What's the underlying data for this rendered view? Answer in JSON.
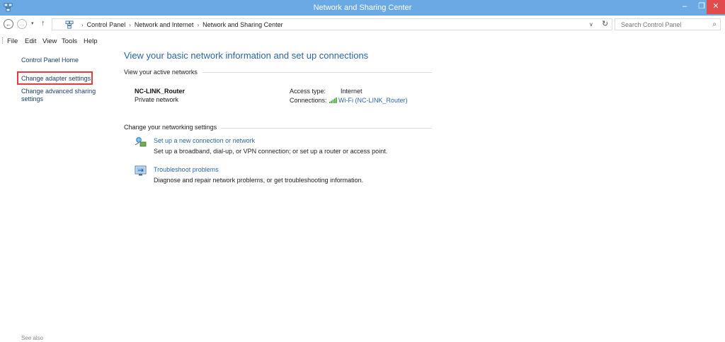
{
  "window": {
    "title": "Network and Sharing Center"
  },
  "window_controls": {
    "minimize": "–",
    "maximize": "❐",
    "close": "✕"
  },
  "nav": {
    "back": "←",
    "forward": "→",
    "recent": "▾",
    "up": "↑"
  },
  "address": {
    "crumbs": [
      "Control Panel",
      "Network and Internet",
      "Network and Sharing Center"
    ],
    "separator": "›",
    "dropdown": "∨",
    "refresh": "↻"
  },
  "search": {
    "placeholder": "Search Control Panel",
    "icon": "⌕"
  },
  "menu": {
    "items": [
      "File",
      "Edit",
      "View",
      "Tools",
      "Help"
    ]
  },
  "sidebar": {
    "home": "Control Panel Home",
    "change_adapter": "Change adapter settings",
    "change_sharing": "Change advanced sharing settings",
    "see_also": "See also"
  },
  "main": {
    "title": "View your basic network information and set up connections",
    "active_networks_heading": "View your active networks",
    "network": {
      "name": "NC-LINK_Router",
      "type": "Private network",
      "access_type_label": "Access type:",
      "access_type_value": "Internet",
      "connections_label": "Connections:",
      "connections_value": "Wi-Fi (NC-LINK_Router)"
    },
    "change_settings_heading": "Change your networking settings",
    "tasks": [
      {
        "link": "Set up a new connection or network",
        "desc": "Set up a broadband, dial-up, or VPN connection; or set up a router or access point."
      },
      {
        "link": "Troubleshoot problems",
        "desc": "Diagnose and repair network problems, or get troubleshooting information."
      }
    ]
  },
  "colors": {
    "titlebar": "#6aa9e3",
    "close": "#e14b4b",
    "link": "#2a67a8",
    "highlight": "#e53b3b"
  }
}
